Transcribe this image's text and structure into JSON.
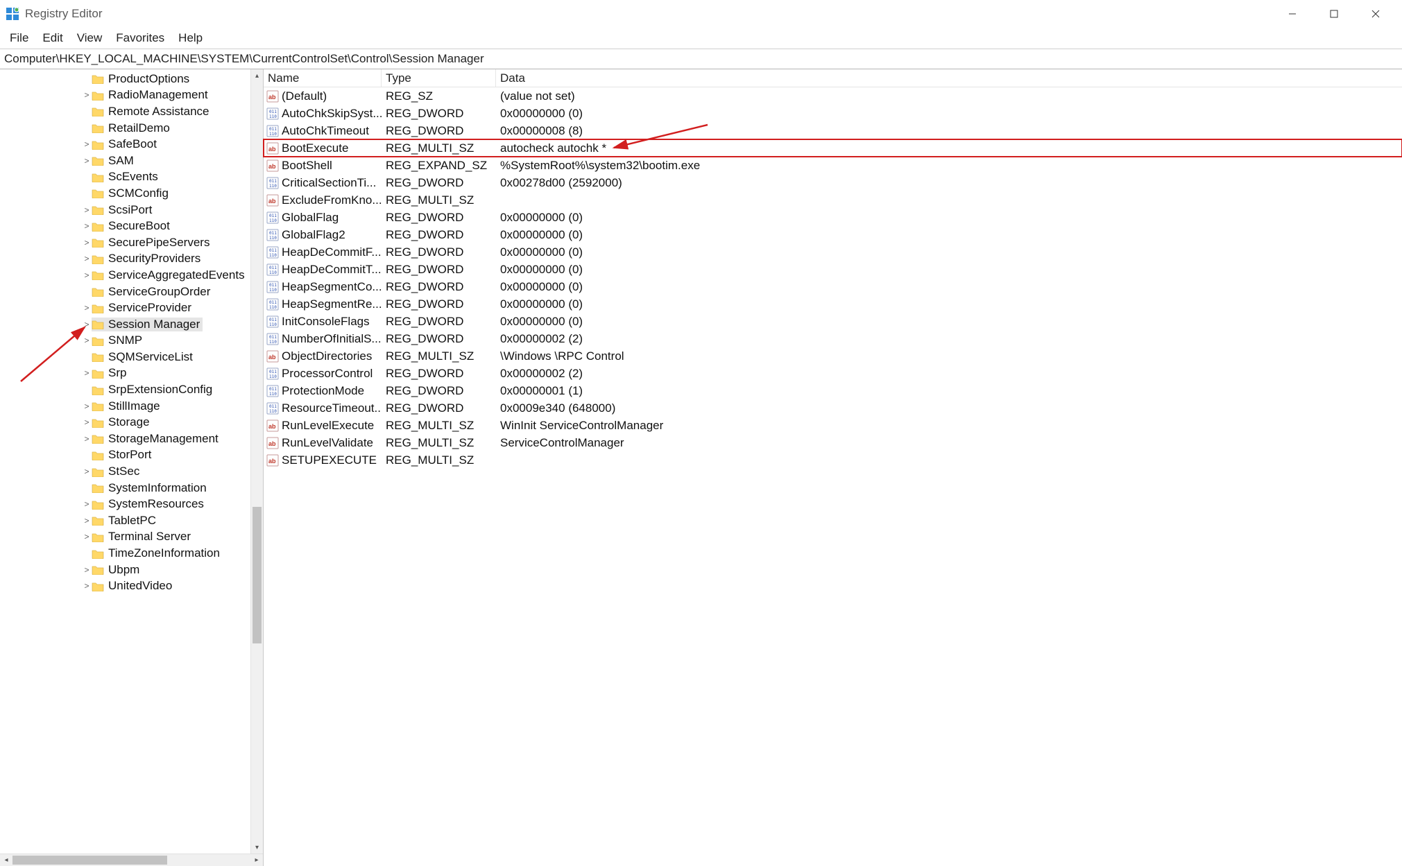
{
  "window": {
    "title": "Registry Editor"
  },
  "menu": {
    "file": "File",
    "edit": "Edit",
    "view": "View",
    "favorites": "Favorites",
    "help": "Help"
  },
  "address": "Computer\\HKEY_LOCAL_MACHINE\\SYSTEM\\CurrentControlSet\\Control\\Session Manager",
  "tree": {
    "indent_base": 136,
    "items": [
      {
        "label": "ProductOptions",
        "expander": ""
      },
      {
        "label": "RadioManagement",
        "expander": ">"
      },
      {
        "label": "Remote Assistance",
        "expander": ""
      },
      {
        "label": "RetailDemo",
        "expander": ""
      },
      {
        "label": "SafeBoot",
        "expander": ">"
      },
      {
        "label": "SAM",
        "expander": ">"
      },
      {
        "label": "ScEvents",
        "expander": ""
      },
      {
        "label": "SCMConfig",
        "expander": ""
      },
      {
        "label": "ScsiPort",
        "expander": ">"
      },
      {
        "label": "SecureBoot",
        "expander": ">"
      },
      {
        "label": "SecurePipeServers",
        "expander": ">"
      },
      {
        "label": "SecurityProviders",
        "expander": ">"
      },
      {
        "label": "ServiceAggregatedEvents",
        "expander": ">"
      },
      {
        "label": "ServiceGroupOrder",
        "expander": ""
      },
      {
        "label": "ServiceProvider",
        "expander": ">"
      },
      {
        "label": "Session Manager",
        "expander": ">",
        "selected": true
      },
      {
        "label": "SNMP",
        "expander": ">"
      },
      {
        "label": "SQMServiceList",
        "expander": ""
      },
      {
        "label": "Srp",
        "expander": ">"
      },
      {
        "label": "SrpExtensionConfig",
        "expander": ""
      },
      {
        "label": "StillImage",
        "expander": ">"
      },
      {
        "label": "Storage",
        "expander": ">"
      },
      {
        "label": "StorageManagement",
        "expander": ">"
      },
      {
        "label": "StorPort",
        "expander": ""
      },
      {
        "label": "StSec",
        "expander": ">"
      },
      {
        "label": "SystemInformation",
        "expander": ""
      },
      {
        "label": "SystemResources",
        "expander": ">"
      },
      {
        "label": "TabletPC",
        "expander": ">"
      },
      {
        "label": "Terminal Server",
        "expander": ">"
      },
      {
        "label": "TimeZoneInformation",
        "expander": ""
      },
      {
        "label": "Ubpm",
        "expander": ">"
      },
      {
        "label": "UnitedVideo",
        "expander": ">"
      }
    ]
  },
  "list": {
    "columns": {
      "name": "Name",
      "type": "Type",
      "data": "Data"
    },
    "rows": [
      {
        "icon": "sz",
        "name": "(Default)",
        "type": "REG_SZ",
        "data": "(value not set)"
      },
      {
        "icon": "bin",
        "name": "AutoChkSkipSyst...",
        "type": "REG_DWORD",
        "data": "0x00000000 (0)"
      },
      {
        "icon": "bin",
        "name": "AutoChkTimeout",
        "type": "REG_DWORD",
        "data": "0x00000008 (8)"
      },
      {
        "icon": "sz",
        "name": "BootExecute",
        "type": "REG_MULTI_SZ",
        "data": "autocheck autochk *",
        "highlight": true
      },
      {
        "icon": "sz",
        "name": "BootShell",
        "type": "REG_EXPAND_SZ",
        "data": "%SystemRoot%\\system32\\bootim.exe"
      },
      {
        "icon": "bin",
        "name": "CriticalSectionTi...",
        "type": "REG_DWORD",
        "data": "0x00278d00 (2592000)"
      },
      {
        "icon": "sz",
        "name": "ExcludeFromKno...",
        "type": "REG_MULTI_SZ",
        "data": ""
      },
      {
        "icon": "bin",
        "name": "GlobalFlag",
        "type": "REG_DWORD",
        "data": "0x00000000 (0)"
      },
      {
        "icon": "bin",
        "name": "GlobalFlag2",
        "type": "REG_DWORD",
        "data": "0x00000000 (0)"
      },
      {
        "icon": "bin",
        "name": "HeapDeCommitF...",
        "type": "REG_DWORD",
        "data": "0x00000000 (0)"
      },
      {
        "icon": "bin",
        "name": "HeapDeCommitT...",
        "type": "REG_DWORD",
        "data": "0x00000000 (0)"
      },
      {
        "icon": "bin",
        "name": "HeapSegmentCo...",
        "type": "REG_DWORD",
        "data": "0x00000000 (0)"
      },
      {
        "icon": "bin",
        "name": "HeapSegmentRe...",
        "type": "REG_DWORD",
        "data": "0x00000000 (0)"
      },
      {
        "icon": "bin",
        "name": "InitConsoleFlags",
        "type": "REG_DWORD",
        "data": "0x00000000 (0)"
      },
      {
        "icon": "bin",
        "name": "NumberOfInitialS...",
        "type": "REG_DWORD",
        "data": "0x00000002 (2)"
      },
      {
        "icon": "sz",
        "name": "ObjectDirectories",
        "type": "REG_MULTI_SZ",
        "data": "\\Windows \\RPC Control"
      },
      {
        "icon": "bin",
        "name": "ProcessorControl",
        "type": "REG_DWORD",
        "data": "0x00000002 (2)"
      },
      {
        "icon": "bin",
        "name": "ProtectionMode",
        "type": "REG_DWORD",
        "data": "0x00000001 (1)"
      },
      {
        "icon": "bin",
        "name": "ResourceTimeout...",
        "type": "REG_DWORD",
        "data": "0x0009e340 (648000)"
      },
      {
        "icon": "sz",
        "name": "RunLevelExecute",
        "type": "REG_MULTI_SZ",
        "data": "WinInit ServiceControlManager"
      },
      {
        "icon": "sz",
        "name": "RunLevelValidate",
        "type": "REG_MULTI_SZ",
        "data": "ServiceControlManager"
      },
      {
        "icon": "sz",
        "name": "SETUPEXECUTE",
        "type": "REG_MULTI_SZ",
        "data": ""
      }
    ]
  }
}
